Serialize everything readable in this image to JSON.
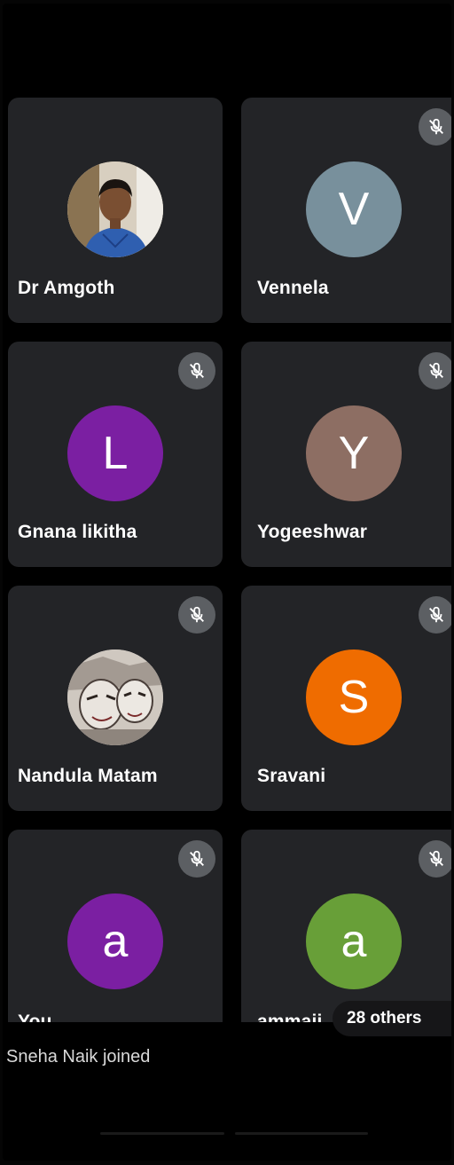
{
  "participants": [
    {
      "name": "Dr Amgoth",
      "avatar_letter": "",
      "avatar_type": "photo-man",
      "avatar_color": "#c9b48a",
      "muted": false
    },
    {
      "name": "Vennela",
      "avatar_letter": "V",
      "avatar_type": "letter",
      "avatar_color": "#78909c",
      "muted": true
    },
    {
      "name": "Gnana likitha",
      "avatar_letter": "L",
      "avatar_type": "letter",
      "avatar_color": "#7b1fa2",
      "muted": true
    },
    {
      "name": "Yogeeshwar",
      "avatar_letter": "Y",
      "avatar_type": "letter",
      "avatar_color": "#8d6e63",
      "muted": true
    },
    {
      "name": "Nandula Matam",
      "avatar_letter": "",
      "avatar_type": "photo-drawing",
      "avatar_color": "#b9b3ad",
      "muted": true
    },
    {
      "name": "Sravani",
      "avatar_letter": "S",
      "avatar_type": "letter",
      "avatar_color": "#ef6c00",
      "muted": true
    },
    {
      "name": "You",
      "avatar_letter": "a",
      "avatar_type": "letter",
      "avatar_color": "#7b1fa2",
      "muted": true
    },
    {
      "name": "ammaji",
      "avatar_letter": "a",
      "avatar_type": "letter",
      "avatar_color": "#689f38",
      "muted": true
    }
  ],
  "others_chip": {
    "label": "28 others"
  },
  "toast": {
    "text": "Sneha Naik joined"
  },
  "icons": {
    "mute": "mic-off-icon"
  },
  "colors": {
    "tile_bg": "#232427",
    "background": "#000000",
    "mute_bg": "#5c5f63"
  }
}
